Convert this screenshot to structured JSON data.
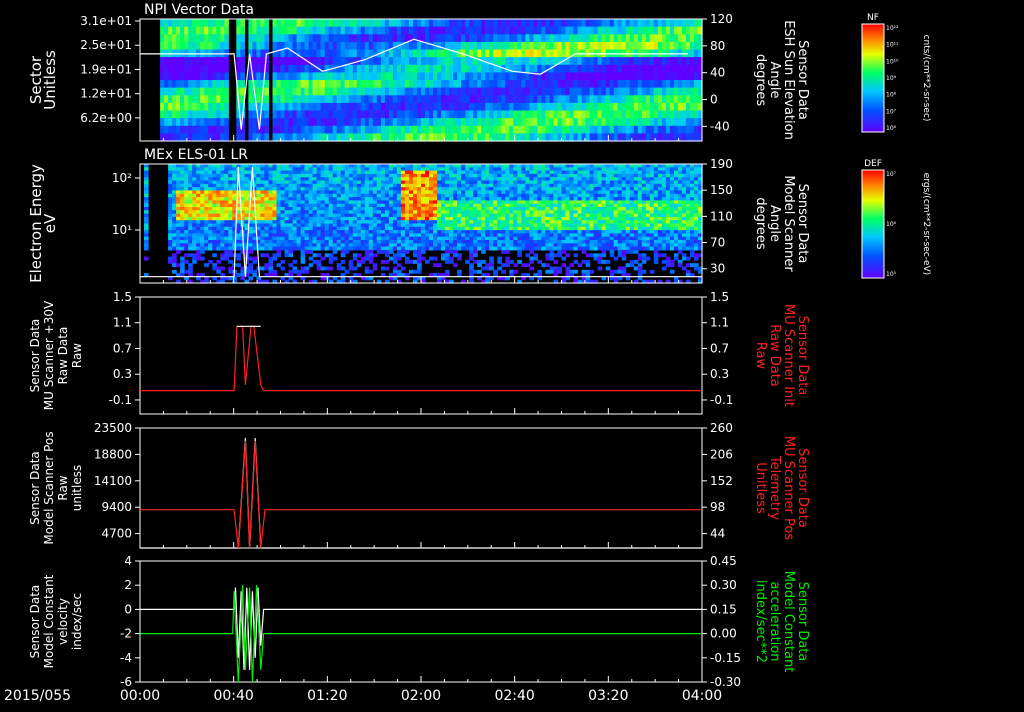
{
  "date_label": "2015/055",
  "time_ticks": [
    "00:00",
    "00:40",
    "01:20",
    "02:00",
    "02:40",
    "03:20",
    "04:00"
  ],
  "colors": {
    "background": "#000000",
    "axis": "#ffffff",
    "red_trace": "#ff2020",
    "green_trace": "#00ee00",
    "white_trace": "#ffffff"
  },
  "colorbars": [
    {
      "tag": "NF",
      "unit": "cnts/(cm**2-sr-sec)",
      "ticks": [
        "10¹²",
        "10¹¹",
        "10¹⁰",
        "10⁹",
        "10⁸",
        "10⁷",
        "10⁶"
      ]
    },
    {
      "tag": "DEF",
      "unit": "ergs/(cm**2-sr-sec-eV)",
      "ticks": [
        "10⁷",
        "10⁶",
        "10⁵"
      ]
    }
  ],
  "chart_data": [
    {
      "type": "heatmap",
      "title": "NPI Vector Data",
      "ylabel_lines": [
        "Sector",
        "Unitless"
      ],
      "y_ticks": [
        "3.1e+01",
        "2.5e+01",
        "1.9e+01",
        "1.2e+01",
        "6.2e+00"
      ],
      "right_ticks": [
        "120",
        "80",
        "40",
        "0",
        "-40"
      ],
      "right_label_lines": [
        "Sensor Data",
        "ESH Sun Elevation",
        "Angle",
        "degrees"
      ],
      "right_label_color": "#ffffff",
      "overlay": {
        "name": "ESH Sun Elevation Angle",
        "x_hours": [
          0,
          0.67,
          0.72,
          0.78,
          0.85,
          0.9,
          1.05,
          1.3,
          1.6,
          1.95,
          2.3,
          2.65,
          2.85,
          3.1,
          3.5,
          3.9
        ],
        "y": [
          70,
          70,
          -60,
          70,
          -60,
          70,
          80,
          40,
          60,
          95,
          70,
          40,
          35,
          70,
          70,
          70
        ]
      }
    },
    {
      "type": "heatmap",
      "title": "MEx ELS-01 LR",
      "ylabel_lines": [
        "Electron Energy",
        "eV"
      ],
      "y_ticks": [
        "10²",
        "10¹"
      ],
      "right_ticks": [
        "190",
        "150",
        "110",
        "70",
        "30"
      ],
      "right_label_lines": [
        "Sensor Data",
        "Model Scanner",
        "Angle",
        "degrees"
      ],
      "right_label_color": "#ffffff",
      "overlay": {
        "name": "Model Scanner Angle",
        "x_hours": [
          0,
          0.67,
          0.7,
          0.75,
          0.8,
          0.85,
          0.9,
          4.0
        ],
        "y": [
          10,
          10,
          185,
          10,
          185,
          10,
          10,
          10
        ]
      }
    },
    {
      "type": "line",
      "ylabel_lines": [
        "Sensor Data",
        "MU Scanner +30V",
        "Raw Data",
        "Raw"
      ],
      "y_ticks": [
        "1.5",
        "1.1",
        "0.7",
        "0.3",
        "-0.1"
      ],
      "ylim": [
        -0.5,
        1.5
      ],
      "right_ticks": [
        "1.5",
        "1.1",
        "0.7",
        "0.3",
        "-0.1"
      ],
      "right_label_lines": [
        "Sensor Data",
        "MU Scanner Init",
        "Raw Data",
        "Raw"
      ],
      "right_label_color": "#ff2020",
      "series": [
        {
          "color": "#ff2020",
          "x_hours": [
            0,
            0.67,
            0.69,
            0.73,
            0.75,
            0.79,
            0.81,
            0.86,
            0.88,
            4.0
          ],
          "y": [
            -0.1,
            -0.1,
            1.0,
            1.0,
            0.0,
            1.0,
            1.0,
            0.0,
            -0.1,
            -0.1
          ]
        },
        {
          "color": "#ffffff",
          "x_hours": [
            0.69,
            0.73,
            0.81,
            0.86
          ],
          "y": [
            1.0,
            1.0,
            1.0,
            1.0
          ]
        }
      ]
    },
    {
      "type": "line",
      "ylabel_lines": [
        "Sensor Data",
        "Model Scanner Pos",
        "Raw",
        "unitless"
      ],
      "y_ticks": [
        "23500",
        "18800",
        "14100",
        "9400",
        "4700"
      ],
      "ylim": [
        0,
        23500
      ],
      "right_ticks": [
        "260",
        "206",
        "152",
        "98",
        "44"
      ],
      "right_label_lines": [
        "Sensor Data",
        "MU Scanner Pos",
        "Telemetry",
        "Unitless"
      ],
      "right_label_color": "#ff2020",
      "series": [
        {
          "color": "#ffffff",
          "x_hours": [
            0,
            0.67,
            0.7,
            0.75,
            0.78,
            0.82,
            0.86,
            0.89,
            4.0
          ],
          "y": [
            0,
            0,
            0,
            21500,
            0,
            21500,
            0,
            0,
            0
          ]
        },
        {
          "color": "#ff2020",
          "x_hours": [
            0,
            0.67,
            0.7,
            0.75,
            0.78,
            0.82,
            0.86,
            0.89,
            4.0
          ],
          "y": [
            7500,
            7500,
            0,
            21000,
            0,
            21000,
            0,
            7500,
            7500
          ]
        }
      ]
    },
    {
      "type": "line",
      "ylabel_lines": [
        "Sensor Data",
        "Model Constant",
        "velocity",
        "index/sec"
      ],
      "y_ticks": [
        "4",
        "2",
        "0",
        "-2",
        "-4",
        "-6"
      ],
      "ylim": [
        -6,
        4
      ],
      "right_ticks": [
        "0.45",
        "0.30",
        "0.15",
        "0.00",
        "-0.15",
        "-0.30"
      ],
      "right_label_lines": [
        "Sensor Data",
        "Model Constant",
        "acceleration",
        "index/sec**2"
      ],
      "right_label_color": "#00ee00",
      "series": [
        {
          "color": "#ffffff",
          "x_hours": [
            0,
            0.67,
            0.68,
            0.7,
            0.72,
            0.74,
            0.76,
            0.78,
            0.8,
            0.82,
            0.84,
            0.86,
            0.88,
            4.0
          ],
          "y": [
            0,
            0,
            1.8,
            -4,
            1.5,
            -5,
            1.8,
            -5,
            1.5,
            -4,
            1.8,
            -3,
            0,
            0
          ]
        },
        {
          "color": "#00ee00",
          "x_hours": [
            0,
            0.66,
            0.67,
            0.7,
            0.73,
            0.75,
            0.78,
            0.8,
            0.83,
            0.86,
            0.88,
            4.0
          ],
          "y": [
            -2,
            -2,
            1.5,
            -6,
            2,
            -5,
            1.8,
            -6,
            2,
            -5,
            -2,
            -2
          ]
        }
      ]
    }
  ]
}
